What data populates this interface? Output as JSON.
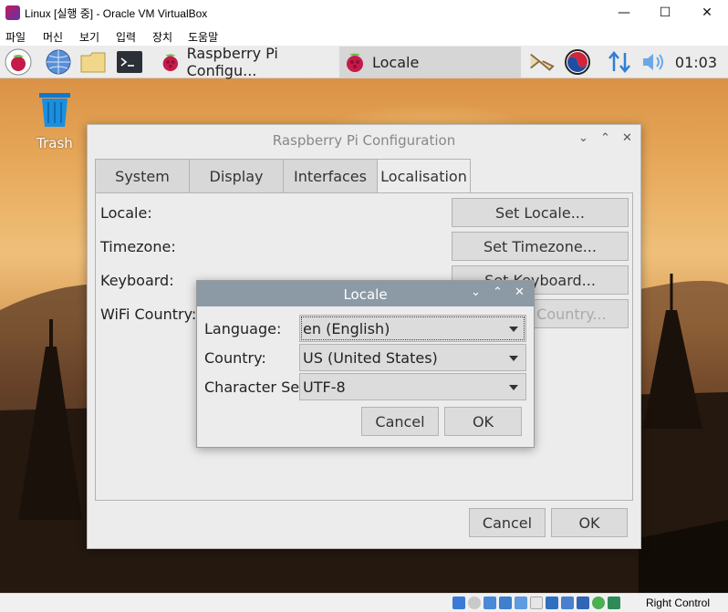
{
  "host": {
    "title": "Linux [실행 중] - Oracle VM VirtualBox",
    "menu": [
      "파일",
      "머신",
      "보기",
      "입력",
      "장치",
      "도움말"
    ],
    "window_buttons": {
      "minimize": "—",
      "maximize": "☐",
      "close": "✕"
    },
    "status": {
      "right_control": "Right Control"
    }
  },
  "taskbar": {
    "tasks": [
      {
        "label": "Raspberry Pi Configu...",
        "active": false
      },
      {
        "label": "Locale",
        "active": true
      }
    ],
    "clock": "01:03",
    "icons": [
      "raspberry-menu-icon",
      "web-browser-icon",
      "file-manager-icon",
      "terminal-icon",
      "bluetooth-icon",
      "input-method-icon",
      "network-icon",
      "volume-icon"
    ]
  },
  "desktop": {
    "trash_label": "Trash"
  },
  "config": {
    "title": "Raspberry Pi Configuration",
    "tabs": [
      "System",
      "Display",
      "Interfaces",
      "Localisation"
    ],
    "active_tab": "Localisation",
    "rows": [
      {
        "label": "Locale:",
        "button": "Set Locale..."
      },
      {
        "label": "Timezone:",
        "button": "Set Timezone..."
      },
      {
        "label": "Keyboard:",
        "button": "Set Keyboard..."
      },
      {
        "label": "WiFi Country:",
        "button": "Set WiFi Country..."
      }
    ],
    "cancel": "Cancel",
    "ok": "OK"
  },
  "locale": {
    "title": "Locale",
    "language_label": "Language:",
    "language_value": "en (English)",
    "country_label": "Country:",
    "country_value": "US (United States)",
    "charset_label": "Character Set:",
    "charset_value": "UTF-8",
    "cancel": "Cancel",
    "ok": "OK"
  },
  "colors": {
    "locale_titlebar": "#8c9aa6",
    "taskbar": "#ececec",
    "window_bg": "#ececec"
  }
}
